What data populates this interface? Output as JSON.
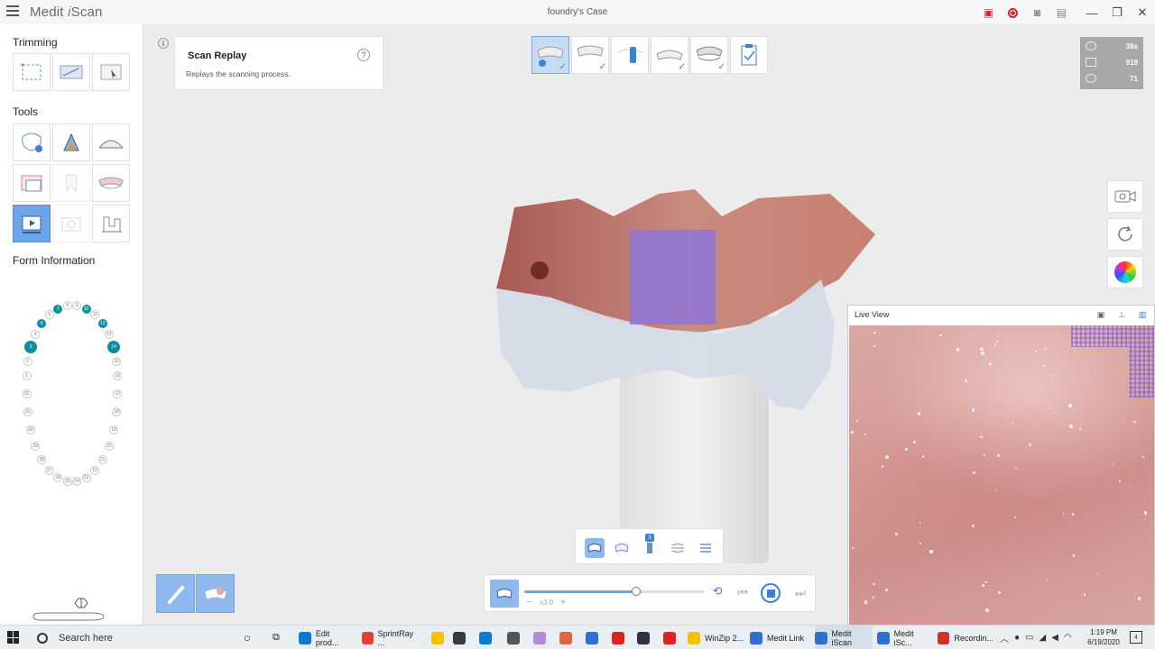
{
  "titlebar": {
    "app_name_a": "Medit ",
    "app_name_b": "i",
    "app_name_c": "Scan",
    "case_title": "foundry's Case"
  },
  "left_panel": {
    "trimming_label": "Trimming",
    "tools_label": "Tools",
    "form_info_label": "Form Information"
  },
  "tooth_chart": {
    "upper": [
      "1",
      "2",
      "3",
      "4",
      "5",
      "6",
      "7",
      "8",
      "9",
      "10",
      "11",
      "12",
      "13",
      "14",
      "15",
      "16"
    ],
    "lower": [
      "17",
      "18",
      "19",
      "20",
      "21",
      "22",
      "23",
      "24",
      "25",
      "26",
      "27",
      "28",
      "29",
      "30",
      "31",
      "32"
    ],
    "filled": [
      "3",
      "5",
      "7",
      "10",
      "12",
      "14"
    ],
    "filled_color": "#0b8fa0"
  },
  "replay_card": {
    "title": "Scan Replay",
    "description": "Replays the scanning process.",
    "help": "?",
    "info": "i"
  },
  "stats": {
    "time": "38s",
    "frames": "919",
    "rotations": "71"
  },
  "live_view": {
    "title": "Live View"
  },
  "segment_bar": {
    "badge": "3"
  },
  "player": {
    "speed": "x3.0",
    "minus": "−",
    "plus": "+",
    "progress": 0.62,
    "accent": "#3b7fd6"
  },
  "taskbar": {
    "search_placeholder": "Search here",
    "apps": [
      {
        "label": "Edit prod...",
        "color": "#0b7ad4"
      },
      {
        "label": "SprintRay ...",
        "color": "#e44134"
      },
      {
        "label": "WinZip 2...",
        "color": "#f2c200"
      },
      {
        "label": "Medit Link",
        "color": "#2f6fd0"
      },
      {
        "label": "Medit iScan",
        "color": "#2f6fd0"
      },
      {
        "label": "Medit iSc...",
        "color": "#2f6fd0"
      },
      {
        "label": "Recordin...",
        "color": "#d0312d"
      }
    ],
    "time": "1:19 PM",
    "date": "6/19/2020",
    "notifications": "4"
  }
}
